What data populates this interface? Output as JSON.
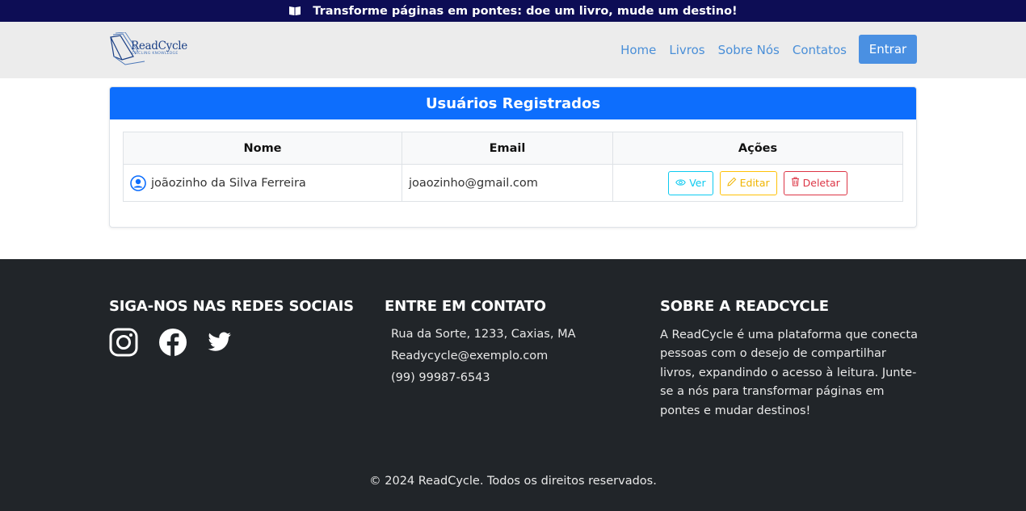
{
  "banner": {
    "icon": "book-icon",
    "text": "Transforme páginas em pontes: doe um livro, mude um destino!"
  },
  "navbar": {
    "logo_title": "ReadCycle",
    "logo_subtitle": "CIRCLING KNOWLEDGE",
    "links": [
      "Home",
      "Livros",
      "Sobre Nós",
      "Contatos"
    ],
    "login_label": "Entrar"
  },
  "users_card": {
    "title": "Usuários Registrados",
    "columns": [
      "Nome",
      "Email",
      "Ações"
    ],
    "rows": [
      {
        "name": "joãozinho da Silva Ferreira",
        "email": "joaozinho@gmail.com",
        "actions": [
          "Ver",
          "Editar",
          "Deletar"
        ]
      }
    ]
  },
  "footer": {
    "social_title": "SIGA-NOS NAS REDES SOCIAIS",
    "social_icons": [
      "instagram-icon",
      "facebook-icon",
      "twitter-icon"
    ],
    "contact_title": "ENTRE EM CONTATO",
    "contact_lines": [
      "Rua da Sorte, 1233, Caxias, MA",
      "Readycycle@exemplo.com",
      "(99) 99987-6543"
    ],
    "about_title": "SOBRE A READCYCLE",
    "about_text": "A ReadCycle é uma plataforma que conecta pessoas com o desejo de compartilhar livros, expandindo o acesso à leitura. Junte-se a nós para transformar páginas em pontes e mudar destinos!",
    "copyright": "© 2024 ReadCycle. Todos os direitos reservados."
  },
  "colors": {
    "banner_bg": "#0d0d55",
    "navbar_bg": "#ececec",
    "primary": "#0d6efd",
    "link": "#4a8fd8",
    "footer_bg": "#212529"
  }
}
